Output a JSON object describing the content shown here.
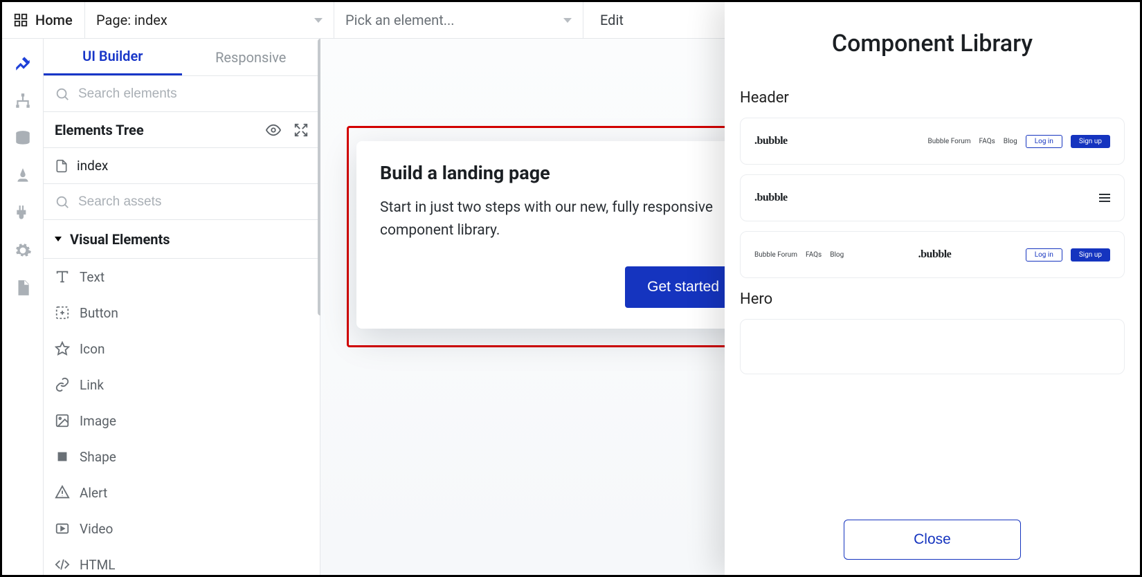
{
  "topbar": {
    "home": "Home",
    "page_label": "Page: index",
    "pick_placeholder": "Pick an element...",
    "edit": "Edit"
  },
  "tabs": {
    "builder": "UI Builder",
    "responsive": "Responsive"
  },
  "search": {
    "elements_placeholder": "Search elements",
    "assets_placeholder": "Search assets"
  },
  "tree": {
    "header": "Elements Tree",
    "root": "index"
  },
  "category": {
    "visual": "Visual Elements"
  },
  "elements": {
    "text": "Text",
    "button": "Button",
    "icon": "Icon",
    "link": "Link",
    "image": "Image",
    "shape": "Shape",
    "alert": "Alert",
    "video": "Video",
    "html": "HTML"
  },
  "onboard": {
    "title": "Build a landing page",
    "body": "Start in just two steps with our new, fully responsive component library.",
    "cta": "Get started"
  },
  "panel": {
    "title": "Component Library",
    "section_header": "Header",
    "section_hero": "Hero",
    "close": "Close",
    "brand": ".bubble",
    "nav": {
      "forum": "Bubble Forum",
      "faqs": "FAQs",
      "blog": "Blog",
      "login": "Log in",
      "signup": "Sign up"
    }
  }
}
